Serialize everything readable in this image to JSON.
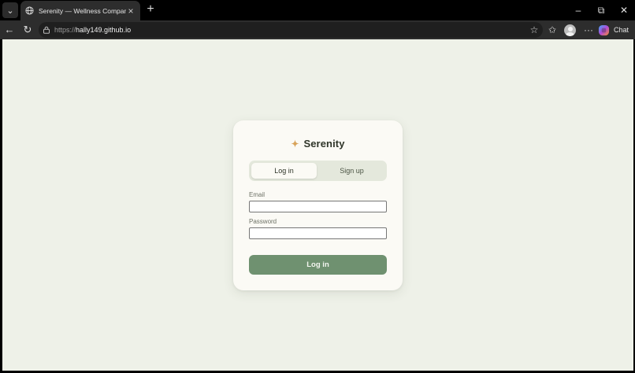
{
  "browser": {
    "tab_title": "Serenity — Wellness Companion",
    "url_prefix": "https://",
    "url_host": "hally149.github.io",
    "chat_label": "Chat"
  },
  "icons": {
    "tab_list": "chevron-down-icon",
    "tab_favicon": "globe-icon",
    "tab_close": "close-icon",
    "new_tab": "plus-icon",
    "back": "back-arrow-icon",
    "reload": "reload-icon",
    "site_info": "lock-icon",
    "favorite": "star-icon",
    "favorites": "favorites-icon",
    "profile": "profile-icon",
    "more": "more-icon",
    "copilot": "copilot-icon",
    "minimize": "minimize-icon",
    "restore": "restore-icon",
    "close": "close-icon",
    "brand": "sparkle-icon"
  },
  "app": {
    "brand_name": "Serenity",
    "tabs": [
      {
        "label": "Log in",
        "active": true
      },
      {
        "label": "Sign up",
        "active": false
      }
    ],
    "email": {
      "label": "Email",
      "value": "",
      "placeholder": ""
    },
    "password": {
      "label": "Password",
      "value": "",
      "placeholder": ""
    },
    "submit_label": "Log in"
  },
  "colors": {
    "page_background": "#eef1e8",
    "card_background": "#fbfaf5",
    "accent": "#6f9170",
    "sparkle": "#d8a35a"
  }
}
